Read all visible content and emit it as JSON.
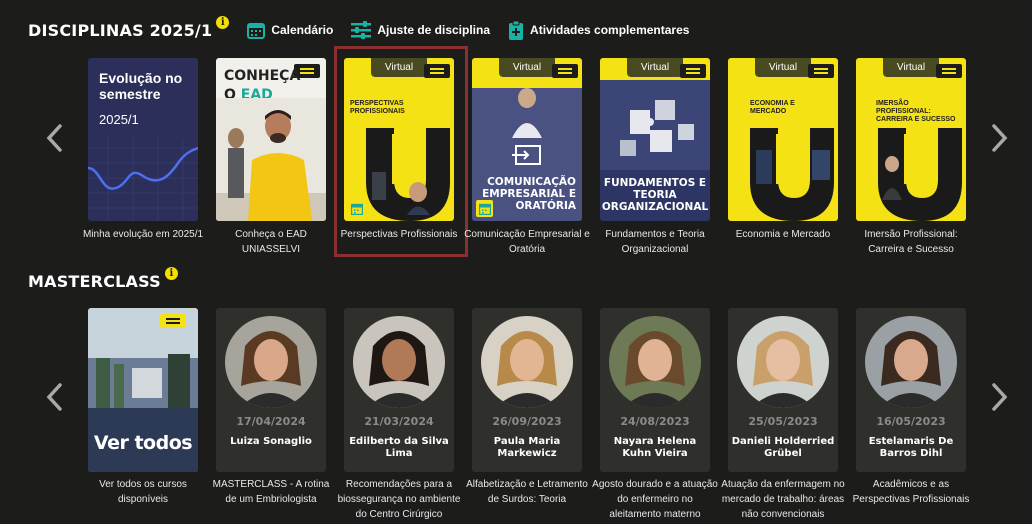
{
  "disciplinas": {
    "title": "DISCIPLINAS 2025/1",
    "info": "i",
    "tools": [
      {
        "label": "Calendário",
        "icon": "calendar-icon"
      },
      {
        "label": "Ajuste de disciplina",
        "icon": "sliders-icon"
      },
      {
        "label": "Atividades complementares",
        "icon": "clipboard-plus-icon"
      }
    ],
    "evolucao": {
      "title": "Evolução no semestre",
      "period": "2025/1",
      "caption": "Minha evolução em 2025/1"
    },
    "conheca": {
      "line1": "CONHEÇA",
      "line2a": "O ",
      "line2b": "EAD",
      "caption": "Conheça o EAD UNIASSELVI"
    },
    "courses": [
      {
        "badge": "Virtual",
        "cover_text": "PERSPECTIVAS PROFISSIONAIS",
        "caption": "Perspectivas Profissionais"
      },
      {
        "badge": "Virtual",
        "cover_text": "COMUNICAÇÃO EMPRESARIAL E ORATÓRIA",
        "caption": "Comunicação Empresarial e Oratória"
      },
      {
        "badge": "Virtual",
        "cover_text": "FUNDAMENTOS E TEORIA ORGANIZACIONAL",
        "caption": "Fundamentos e Teoria Organizacional"
      },
      {
        "badge": "Virtual",
        "cover_text": "ECONOMIA E MERCADO",
        "caption": "Economia e Mercado"
      },
      {
        "badge": "Virtual",
        "cover_text": "IMERSÃO PROFISSIONAL: CARREIRA E SUCESSO",
        "caption": "Imersão Profissional: Carreira e Sucesso"
      }
    ]
  },
  "masterclass": {
    "title": "MASTERCLASS",
    "info": "i",
    "ver_todos": {
      "label": "Ver todos",
      "caption": "Ver todos os cursos disponíveis"
    },
    "items": [
      {
        "date": "17/04/2024",
        "name": "Luiza Sonaglio",
        "caption": "MASTERCLASS - A rotina de um Embriologista",
        "skin": "#d9a88a",
        "hair": "#5a3a22",
        "bg": "#a7a49c"
      },
      {
        "date": "21/03/2024",
        "name": "Edilberto da Silva Lima",
        "caption": "Recomendações para a biossegurança no ambiente do Centro Cirúrgico",
        "skin": "#b07a58",
        "hair": "#1e1714",
        "bg": "#c9c5bd"
      },
      {
        "date": "26/09/2023",
        "name": "Paula Maria Markewicz",
        "caption": "Alfabetização e Letramento de Surdos: Teoria",
        "skin": "#e2b593",
        "hair": "#b88a4a",
        "bg": "#d8d2c6"
      },
      {
        "date": "24/08/2023",
        "name": "Nayara Helena Kuhn Vieira",
        "caption": "Agosto dourado e a atuação do enfermeiro no aleitamento materno",
        "skin": "#e0b394",
        "hair": "#6a4a2c",
        "bg": "#6d7a55"
      },
      {
        "date": "25/05/2023",
        "name": "Danieli Holderried Grübel",
        "caption": "Atuação da enfermagem no mercado de trabalho: áreas não convencionais",
        "skin": "#e6bea2",
        "hair": "#caa06a",
        "bg": "#cfd3d0"
      },
      {
        "date": "16/05/2023",
        "name": "Estelamaris De Barros Dihl",
        "caption": "Acadêmicos e as Perspectivas Profissionais",
        "skin": "#d8a98c",
        "hair": "#3b2a20",
        "bg": "#9aa0a3"
      }
    ]
  },
  "colors": {
    "accent": "#f5e214",
    "background": "#1c1d1b",
    "card": "#2f302c",
    "highlight": "#8a3030"
  }
}
